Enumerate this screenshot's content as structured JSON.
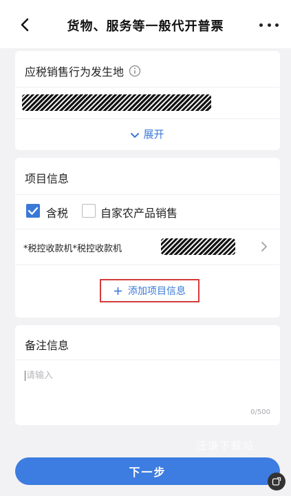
{
  "header": {
    "title": "货物、服务等一般代开普票"
  },
  "location_section": {
    "label": "应税销售行为发生地",
    "expand_label": "展开"
  },
  "project_section": {
    "title": "项目信息",
    "tax_included_label": "含税",
    "tax_included_checked": true,
    "farm_sales_label": "自家农产品销售",
    "farm_sales_checked": false,
    "item_name": "*税控收款机*税控收款机",
    "add_label": "添加项目信息"
  },
  "remarks_section": {
    "title": "备注信息",
    "placeholder": "请输入",
    "counter": "0/500"
  },
  "footer": {
    "next_label": "下一步",
    "watermark": "汪谦下载站"
  },
  "colors": {
    "accent": "#3d7ce0",
    "highlight_border": "#d33a3a",
    "background": "#f2f2f4"
  }
}
